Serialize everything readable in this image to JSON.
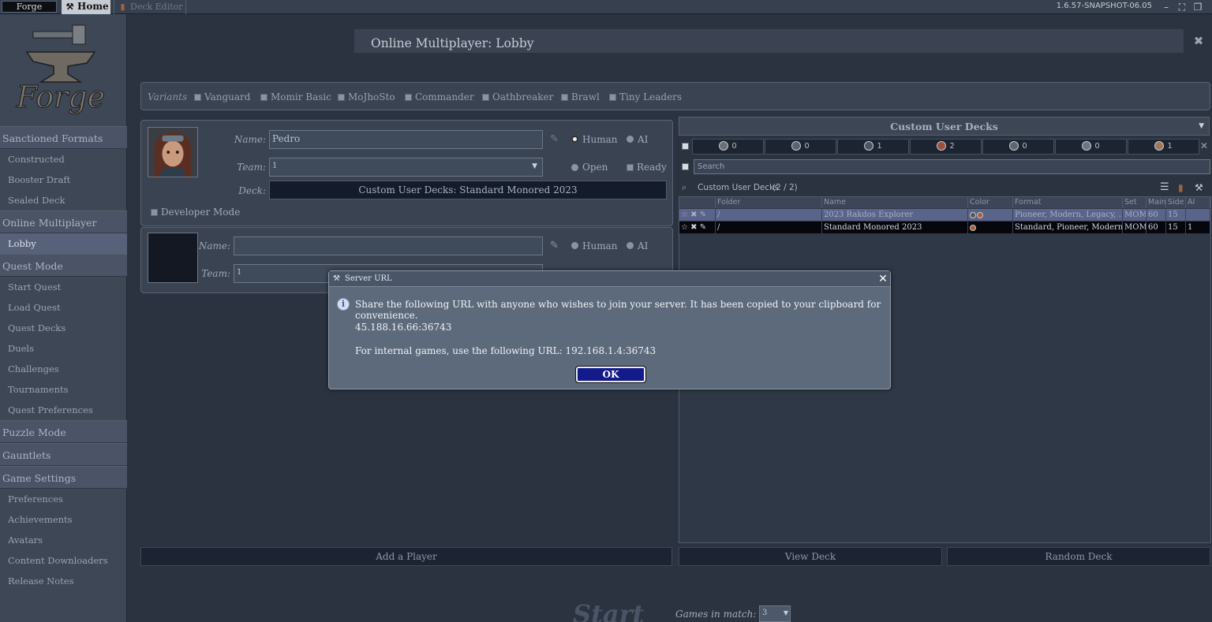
{
  "topbar": {
    "forge_tab": "Forge",
    "home_tab": "Home",
    "deck_editor_tab": "Deck Editor",
    "version": "1.6.57-SNAPSHOT-06.05"
  },
  "sidebar": {
    "logo_text": "Forge",
    "sections": {
      "sanctioned": "Sanctioned Formats",
      "online": "Online Multiplayer",
      "quest": "Quest Mode",
      "puzzle": "Puzzle Mode",
      "gauntlets": "Gauntlets",
      "settings": "Game Settings"
    },
    "sanctioned_items": [
      "Constructed",
      "Booster Draft",
      "Sealed Deck"
    ],
    "online_items": [
      "Lobby"
    ],
    "quest_items": [
      "Start Quest",
      "Load Quest",
      "Quest Decks",
      "Duels",
      "Challenges",
      "Tournaments",
      "Quest Preferences"
    ],
    "settings_items": [
      "Preferences",
      "Achievements",
      "Avatars",
      "Content Downloaders",
      "Release Notes"
    ]
  },
  "lobby": {
    "title": "Online Multiplayer: Lobby",
    "variants_label": "Variants",
    "variants": [
      "Vanguard",
      "Momir Basic",
      "MoJhoSto",
      "Commander",
      "Oathbreaker",
      "Brawl",
      "Tiny Leaders"
    ]
  },
  "player1": {
    "name_label": "Name:",
    "name_value": "Pedro",
    "team_label": "Team:",
    "team_value": "1",
    "deck_label": "Deck:",
    "deck_value": "Custom User Decks: Standard Monored 2023",
    "human": "Human",
    "ai": "AI",
    "open": "Open",
    "ready": "Ready",
    "developer_mode": "Developer Mode"
  },
  "player2": {
    "name_label": "Name:",
    "team_label": "Team:",
    "team_value": "1",
    "human": "Human",
    "ai": "AI"
  },
  "decks": {
    "header": "Custom User Decks",
    "color_counts": [
      "0",
      "0",
      "1",
      "2",
      "0",
      "0",
      "1"
    ],
    "search_placeholder": "Search",
    "list_title": "Custom User Decks",
    "list_count": "(2 / 2)",
    "columns": [
      "Folder",
      "Name",
      "Color",
      "Format",
      "Set",
      "Main",
      "Side",
      "AI"
    ],
    "rows": [
      {
        "folder": "/",
        "name": "2023 Rakdos Explorer",
        "format": "Pioneer, Modern, Legacy, ...",
        "set": "MOM",
        "main": "60",
        "side": "15",
        "ai": ""
      },
      {
        "folder": "/",
        "name": "Standard Monored 2023",
        "format": "Standard, Pioneer, Modern...",
        "set": "MOM",
        "main": "60",
        "side": "15",
        "ai": "1"
      }
    ]
  },
  "buttons": {
    "add_player": "Add a Player",
    "view_deck": "View Deck",
    "random_deck": "Random Deck",
    "start": "Start",
    "games_in_match_label": "Games in match:",
    "games_in_match_value": "3"
  },
  "dialog": {
    "title": "Server URL",
    "line1": "Share the following URL with anyone who wishes to join your server. It has been copied to your clipboard for convenience.",
    "url": "45.188.16.66:36743",
    "line3": "For internal games, use the following URL: 192.168.1.4:36743",
    "ok": "OK"
  }
}
